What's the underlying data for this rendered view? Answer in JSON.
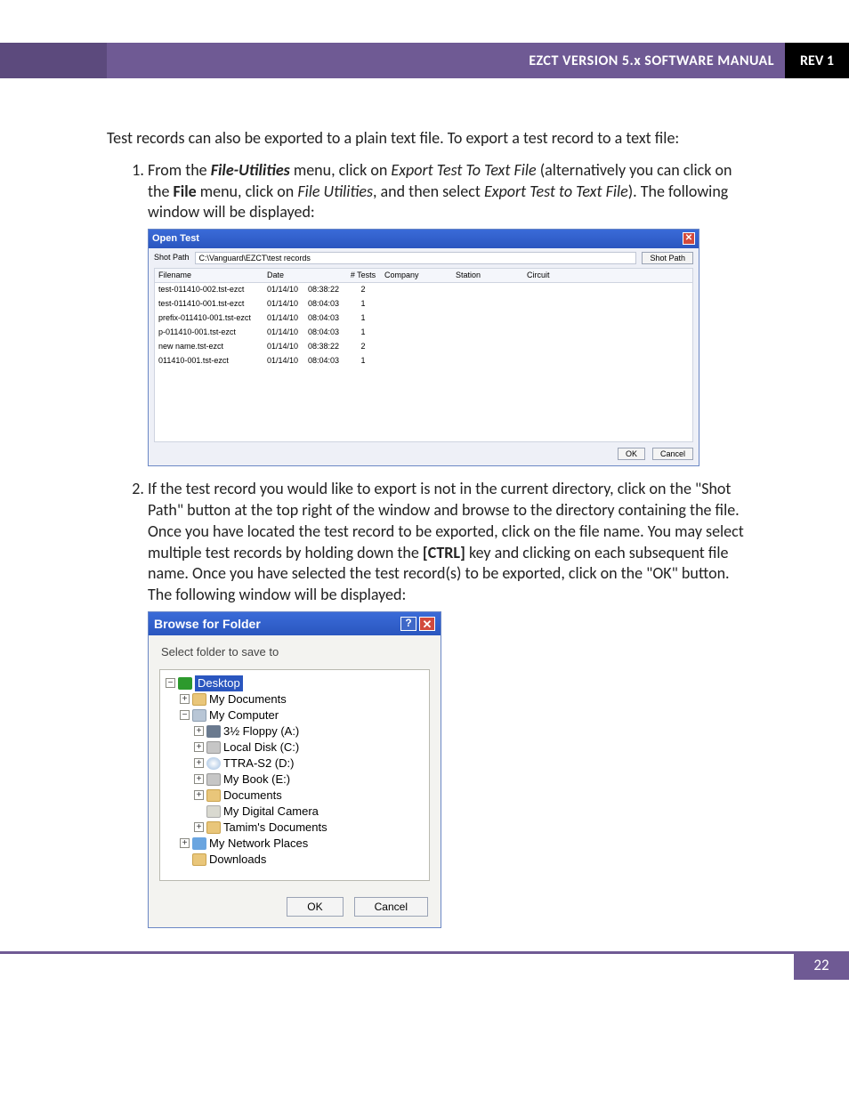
{
  "header": {
    "title": "EZCT VERSION 5.x SOFTWARE MANUAL",
    "rev": "REV 1"
  },
  "intro": "Test records can also be exported to a plain text file. To export a test record to a text file:",
  "step1": {
    "a": "From the ",
    "b": "File-Utilities",
    "c": " menu, click on ",
    "d": "Export Test To Text File",
    "e": " (alternatively you can click on the ",
    "f": "File",
    "g": " menu, click on ",
    "h": "File Utilities",
    "i": ", and then select ",
    "j": "Export Test to Text File",
    "k": "). The following window will be displayed:"
  },
  "open_test": {
    "title": "Open Test",
    "shot_path_label": "Shot Path",
    "path": "C:\\Vanguard\\EZCT\\test records",
    "shot_path_btn": "Shot Path",
    "ok": "OK",
    "cancel": "Cancel",
    "cols": {
      "filename": "Filename",
      "date": "Date",
      "ntests": "# Tests",
      "company": "Company",
      "station": "Station",
      "circuit": "Circuit"
    },
    "rows": [
      {
        "fn": "test-011410-002.tst-ezct",
        "d": "01/14/10",
        "t": "08:38:22",
        "n": "2"
      },
      {
        "fn": "test-011410-001.tst-ezct",
        "d": "01/14/10",
        "t": "08:04:03",
        "n": "1"
      },
      {
        "fn": "prefix-011410-001.tst-ezct",
        "d": "01/14/10",
        "t": "08:04:03",
        "n": "1"
      },
      {
        "fn": "p-011410-001.tst-ezct",
        "d": "01/14/10",
        "t": "08:04:03",
        "n": "1"
      },
      {
        "fn": "new name.tst-ezct",
        "d": "01/14/10",
        "t": "08:38:22",
        "n": "2"
      },
      {
        "fn": "011410-001.tst-ezct",
        "d": "01/14/10",
        "t": "08:04:03",
        "n": "1"
      }
    ]
  },
  "step2": {
    "a": "If the test record you would like to export is not in the current directory, click on the \"Shot Path\" button at the top right of the window and browse to the directory containing the file. Once you have located the test record to be exported, click on the file name. You may select multiple test records by holding down the ",
    "b": "[CTRL]",
    "c": " key and clicking on each subsequent file name. Once you have selected the test record(s) to be exported, click on the \"OK\" button. The following window will be displayed:"
  },
  "bff": {
    "title": "Browse for Folder",
    "msg": "Select folder to save to",
    "nodes": {
      "desktop": "Desktop",
      "mydocs": "My Documents",
      "mycomp": "My Computer",
      "floppy": "3½ Floppy (A:)",
      "cdrive": "Local Disk (C:)",
      "ddrive": "TTRA-S2 (D:)",
      "edrive": "My Book (E:)",
      "documents": "Documents",
      "camera": "My Digital Camera",
      "tamim": "Tamim's Documents",
      "netplaces": "My Network Places",
      "downloads": "Downloads"
    },
    "ok": "OK",
    "cancel": "Cancel"
  },
  "page_number": "22"
}
